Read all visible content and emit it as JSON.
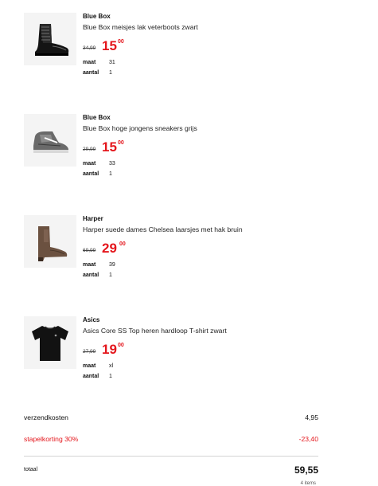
{
  "items": [
    {
      "brand": "Blue Box",
      "name": "Blue Box meisjes lak veterboots zwart",
      "old_price": "34,99",
      "price_main": "15",
      "price_cents": "00",
      "size_label": "maat",
      "size": "31",
      "qty_label": "aantal",
      "qty": "1",
      "icon": "black-patent-lace-up-boot"
    },
    {
      "brand": "Blue Box",
      "name": "Blue Box hoge jongens sneakers grijs",
      "old_price": "29,99",
      "price_main": "15",
      "price_cents": "00",
      "size_label": "maat",
      "size": "33",
      "qty_label": "aantal",
      "qty": "1",
      "icon": "grey-high-top-sneaker"
    },
    {
      "brand": "Harper",
      "name": "Harper suede dames Chelsea laarsjes met hak bruin",
      "old_price": "69,99",
      "price_main": "29",
      "price_cents": "00",
      "size_label": "maat",
      "size": "39",
      "qty_label": "aantal",
      "qty": "1",
      "icon": "brown-suede-chelsea-boot"
    },
    {
      "brand": "Asics",
      "name": "Asics Core SS Top heren hardloop T-shirt zwart",
      "old_price": "27,99",
      "price_main": "19",
      "price_cents": "00",
      "size_label": "maat",
      "size": "xl",
      "qty_label": "aantal",
      "qty": "1",
      "icon": "black-t-shirt"
    }
  ],
  "summary": {
    "shipping_label": "verzendkosten",
    "shipping_value": "4,95",
    "discount_label": "stapelkorting 30%",
    "discount_value": "-23,40",
    "total_label": "totaal",
    "total_value": "59,55",
    "cut_text": "4 items"
  },
  "colors": {
    "sale_red": "#e4161c",
    "thumb_bg": "#f4f4f4"
  }
}
